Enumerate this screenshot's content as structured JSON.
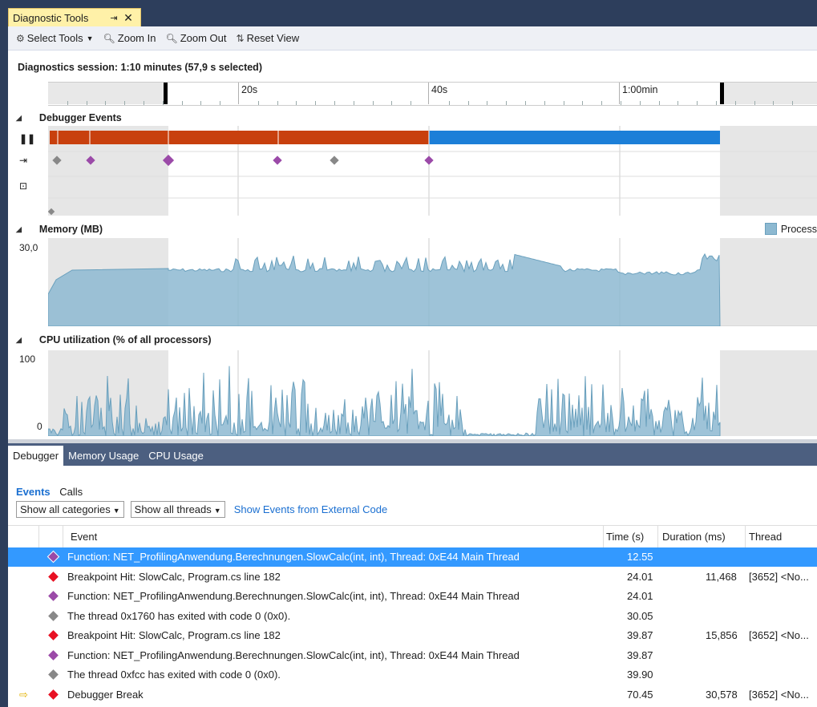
{
  "window": {
    "tab_title": "Diagnostic Tools",
    "pin_glyph": "⇥",
    "close_glyph": "✕"
  },
  "toolbar": {
    "select_tools": "Select Tools",
    "zoom_in": "Zoom In",
    "zoom_out": "Zoom Out",
    "reset_view": "Reset View"
  },
  "session_label": "Diagnostics session: 1:10 minutes (57,9 s selected)",
  "ruler": {
    "ticks": [
      "20s",
      "40s",
      "1:00min"
    ]
  },
  "sections": {
    "debugger_events": "Debugger Events",
    "memory": "Memory (MB)",
    "memory_legend": "Process",
    "memory_max": "30,0",
    "cpu": "CPU utilization (% of all processors)",
    "cpu_max": "100",
    "cpu_min": "0"
  },
  "colors": {
    "break_bar": "#c8400e",
    "run_bar": "#1c7fd8",
    "area": "#8db9d1",
    "purple": "#9b4aa8",
    "gray": "#888888",
    "red": "#e81123"
  },
  "bottom_tabs": [
    "Debugger",
    "Memory Usage",
    "CPU Usage"
  ],
  "subtabs": {
    "events": "Events",
    "calls": "Calls"
  },
  "filters": {
    "categories": "Show all categories",
    "threads": "Show all threads",
    "external": "Show Events from External Code"
  },
  "columns": {
    "event": "Event",
    "time": "Time (s)",
    "duration": "Duration (ms)",
    "thread": "Thread"
  },
  "rows": [
    {
      "kind": "function",
      "event": "Function: NET_ProfilingAnwendung.Berechnungen.SlowCalc(int, int), Thread: 0xE44 Main Thread",
      "time": "12.55",
      "duration": "",
      "thread": "",
      "selected": true
    },
    {
      "kind": "breakpoint",
      "event": "Breakpoint Hit: SlowCalc, Program.cs line 182",
      "time": "24.01",
      "duration": "11,468",
      "thread": "[3652] <No...",
      "selected": false
    },
    {
      "kind": "function",
      "event": "Function: NET_ProfilingAnwendung.Berechnungen.SlowCalc(int, int), Thread: 0xE44 Main Thread",
      "time": "24.01",
      "duration": "",
      "thread": "",
      "selected": false
    },
    {
      "kind": "thread",
      "event": "The thread 0x1760 has exited with code 0 (0x0).",
      "time": "30.05",
      "duration": "",
      "thread": "",
      "selected": false
    },
    {
      "kind": "breakpoint",
      "event": "Breakpoint Hit: SlowCalc, Program.cs line 182",
      "time": "39.87",
      "duration": "15,856",
      "thread": "[3652] <No...",
      "selected": false
    },
    {
      "kind": "function",
      "event": "Function: NET_ProfilingAnwendung.Berechnungen.SlowCalc(int, int), Thread: 0xE44 Main Thread",
      "time": "39.87",
      "duration": "",
      "thread": "",
      "selected": false
    },
    {
      "kind": "thread",
      "event": "The thread 0xfcc has exited with code 0 (0x0).",
      "time": "39.90",
      "duration": "",
      "thread": "",
      "selected": false
    },
    {
      "kind": "break",
      "event": "Debugger Break",
      "time": "70.45",
      "duration": "30,578",
      "thread": "[3652] <No...",
      "selected": false,
      "current": true
    }
  ]
}
